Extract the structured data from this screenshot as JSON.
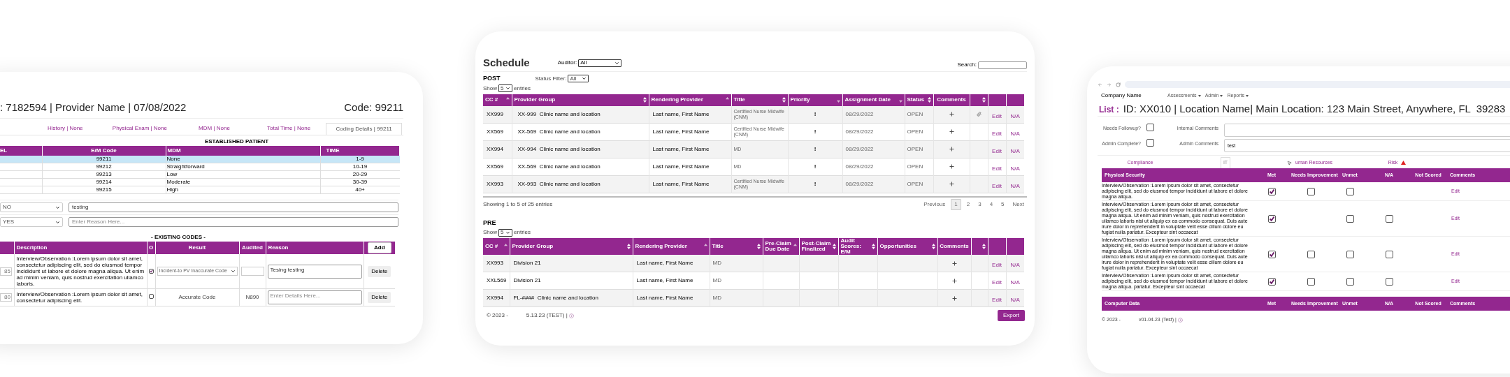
{
  "coding_card": {
    "heading": ": 7182594 | Provider Name | 07/08/2022",
    "code": "Code: 99211",
    "tabs": [
      {
        "label": "History | None",
        "selected": false
      },
      {
        "label": "Physical Exam | None",
        "selected": false
      },
      {
        "label": "MDM | None",
        "selected": false
      },
      {
        "label": "Total Time | None",
        "selected": false
      },
      {
        "label": "Coding Details | 99211",
        "selected": true
      }
    ],
    "table_title": "ESTABLISHED PATIENT",
    "columns": [
      "EL",
      "E/M Code",
      "MDM",
      "TIME"
    ],
    "rows": [
      {
        "code": "99211",
        "mdm": "None",
        "time": "1-9",
        "selected": true
      },
      {
        "code": "99212",
        "mdm": "Straightforward",
        "time": "10-19",
        "selected": false
      },
      {
        "code": "99213",
        "mdm": "Low",
        "time": "20-29",
        "selected": false
      },
      {
        "code": "99214",
        "mdm": "Moderate",
        "time": "30-39",
        "selected": false
      },
      {
        "code": "99215",
        "mdm": "High",
        "time": "40+",
        "selected": false
      }
    ],
    "reason_rows": [
      {
        "answer": "NO",
        "value": "testing"
      },
      {
        "answer": "YES",
        "placeholder": "Enter Reason Here..."
      }
    ],
    "codes_title": "- EXISTING CODES -",
    "codes_columns": [
      "Description",
      "O",
      "Result",
      "Audited",
      "Reason"
    ],
    "add_button": "Add",
    "codes": [
      {
        "code": "85",
        "description": "Interview/Observation :Lorem ipsum dolor sit amet, consectetur adipiscing elit, sed do eiusmod tempor incididunt ut labore et dolore magna aliqua. Ut enim ad minim veniam, quis nostrud exercitation ullamco laboris.",
        "checked": true,
        "kind": "select",
        "result": "Incident-to PV Inaccurate Code",
        "reason": "Tesing testing",
        "delete": "Delete"
      },
      {
        "code": "80",
        "description": "Interview/Observation :Lorem ipsum dolor sit amet, consectetur adipiscing elit.",
        "checked": false,
        "kind": "text",
        "result": "Accurate Code",
        "audited": "N890",
        "reason_placeholder": "Enter Details Here...",
        "delete": "Delete"
      }
    ]
  },
  "schedule_card": {
    "title": "Schedule",
    "auditor_label": "Auditor:",
    "auditor_value": "All",
    "search_label": "Search:",
    "post": {
      "title": "POST",
      "status_filter_label": "Status Filter:",
      "status_filter_value": "All",
      "show": "Show",
      "show_value": "5",
      "entries": "entries",
      "columns": [
        {
          "label": "CC #",
          "arrow_up": true,
          "arrow_down": false
        },
        {
          "label": "Provider Group",
          "arrow_up": true,
          "arrow_down": true
        },
        {
          "label": "Rendering Provider",
          "arrow_up": true,
          "arrow_down": false
        },
        {
          "label": "Title",
          "arrow_up": true,
          "arrow_down": true
        },
        {
          "label": "Priority",
          "arrow_up": false,
          "arrow_down": true
        },
        {
          "label": "Assignment Date",
          "arrow_up": false,
          "arrow_down": true
        },
        {
          "label": "Status",
          "arrow_up": true,
          "arrow_down": true
        },
        {
          "label": "Comments",
          "arrow_up": false,
          "arrow_down": false
        },
        {
          "arrow_up": true,
          "arrow_down": true
        },
        {
          "arrow_up": false,
          "arrow_down": false
        },
        {
          "arrow_up": false,
          "arrow_down": false
        }
      ],
      "rows": [
        {
          "cc": "XX999",
          "group": "XX-999  Clinic name and location",
          "provider": "Last name, First Name",
          "title": "Certified Nurse Midwife (CNM)",
          "priority": "!",
          "date": "08/29/2022",
          "status": "OPEN",
          "attachment": true,
          "edit": "Edit",
          "na": "N/A"
        },
        {
          "cc": "XX569",
          "group": "XX-569  Clinic name and location",
          "provider": "Last name, First Name",
          "title": "Certified Nurse Midwife (CNM)",
          "priority": "!",
          "date": "08/29/2022",
          "status": "OPEN",
          "attachment": false,
          "edit": "Edit",
          "na": "N/A"
        },
        {
          "cc": "XX994",
          "group": "XX-994  Clinic name and location",
          "provider": "Last name, First Name",
          "title": "MD",
          "priority": "!",
          "date": "08/29/2022",
          "status": "OPEN",
          "attachment": false,
          "edit": "Edit",
          "na": "N/A"
        },
        {
          "cc": "XX569",
          "group": "XX-569  Clinic name and location",
          "provider": "Last name, First Name",
          "title": "MD",
          "priority": "!",
          "date": "08/29/2022",
          "status": "OPEN",
          "attachment": false,
          "edit": "Edit",
          "na": "N/A"
        },
        {
          "cc": "XX993",
          "group": "XX-993  Clinic name and location",
          "provider": "Last name, First Name",
          "title": "Certified Nurse Midwife (CNM)",
          "priority": "!",
          "date": "08/29/2022",
          "status": "OPEN",
          "attachment": false,
          "edit": "Edit",
          "na": "N/A"
        }
      ],
      "info": "Showing 1 to 5 of 25 entries",
      "pagination": [
        {
          "label": "Previous",
          "selected": false
        },
        {
          "label": "1",
          "selected": true
        },
        {
          "label": "2",
          "selected": false
        },
        {
          "label": "3",
          "selected": false
        },
        {
          "label": "4",
          "selected": false
        },
        {
          "label": "5",
          "selected": false
        },
        {
          "label": "Next",
          "selected": false
        }
      ]
    },
    "pre": {
      "title": "PRE",
      "show": "Show",
      "show_value": "5",
      "entries": "entries",
      "columns": [
        {
          "label": "CC #",
          "arrow_up": true,
          "arrow_down": false
        },
        {
          "label": "Provider Group",
          "arrow_up": true,
          "arrow_down": true
        },
        {
          "label": "Rendering Provider",
          "arrow_up": true,
          "arrow_down": false
        },
        {
          "label": "Title",
          "arrow_up": true,
          "arrow_down": true
        },
        {
          "label": "Pre-Claim Due Date",
          "arrow_up": true,
          "arrow_down": false
        },
        {
          "label": "Post-Claim Finalized",
          "arrow_up": true,
          "arrow_down": true
        },
        {
          "label": "Audit Scores: E/M",
          "arrow_up": true,
          "arrow_down": true
        },
        {
          "label": "Opportunities",
          "arrow_up": true,
          "arrow_down": true
        },
        {
          "label": "Comments",
          "arrow_up": false,
          "arrow_down": false
        },
        {
          "arrow_up": true,
          "arrow_down": true
        },
        {
          "arrow_up": false,
          "arrow_down": false
        },
        {
          "arrow_up": false,
          "arrow_down": false
        }
      ],
      "rows": [
        {
          "cc": "XX993",
          "group": "Division 21",
          "provider": "Last name, First Name",
          "title": "MD",
          "edit": "Edit",
          "na": "N/A"
        },
        {
          "cc": "XXL569",
          "group": "Division 21",
          "provider": "Last name, First Name",
          "title": "MD",
          "edit": "Edit",
          "na": "N/A"
        },
        {
          "cc": "XX994",
          "group": "FL-####  Clinic name and location",
          "provider": "Last name, First Name",
          "title": "MD",
          "edit": "Edit",
          "na": "N/A"
        }
      ]
    },
    "footer": "© 2023 -",
    "version": "5.13.23 (TEST) |",
    "export": "Export"
  },
  "list_card": {
    "company": "Company Name",
    "menus": [
      "Assessments",
      "Admin",
      "Reports"
    ],
    "list_label": "List :",
    "list_heading": "ID: XX010 | Location Name| Main Location: 123 Main Street, Anywhere, FL  39283",
    "form": [
      {
        "label": "Needs Followup?",
        "checked": false,
        "comment_label": "Internal Comments"
      },
      {
        "label": "Admin Complete?",
        "checked": false,
        "comment_label": "Admin Comments",
        "comment_value": "test"
      }
    ],
    "tabs": [
      {
        "label": "Compliance",
        "selected": false,
        "warning": false
      },
      {
        "label": "IT",
        "selected": true,
        "warning": false
      },
      {
        "label": "uman Resources",
        "selected": false,
        "warning": false
      },
      {
        "label": "Risk",
        "selected": false,
        "warning": true
      }
    ],
    "sections": [
      {
        "title": "Physical Security",
        "columns": [
          "Met",
          "Needs Improvement",
          "Unmet",
          "N/A",
          "Not Scored",
          "Comments"
        ],
        "rows": [
          {
            "text": "Interview/Observation :Lorem ipsum dolor sit amet, consectetur adipiscing elit, sed do eiusmod tempor incididunt ut labore et dolore magna aliqua.",
            "marks": {
              "met": true,
              "needs_improvement": false,
              "unmet": false
            },
            "edit": "Edit"
          },
          {
            "text": "Interview/Observation :Lorem ipsum dolor sit amet, consectetur adipiscing elit, sed do eiusmod tempor incididunt ut labore et dolore magna aliqua. Ut enim ad minim veniam, quis nostrud exercitation ullamco laboris nisi ut aliquip ex ea commodo consequat. Duis aute irure dolor in reprehenderit in voluptate velit esse cillum dolore eu fugiat nulla pariatur. Excepteur sint occaecat",
            "marks": {
              "met": true,
              "unmet": false,
              "na": false
            },
            "edit": "Edit"
          },
          {
            "text": "Interview/Observation :Lorem ipsum dolor sit amet, consectetur adipiscing elit, sed do eiusmod tempor incididunt ut labore et dolore magna aliqua. Ut enim ad minim veniam, quis nostrud exercitation ullamco laboris nisi ut aliquip ex ea commodo consequat. Duis aute irure dolor in reprehenderit in voluptate velit esse cillum dolore eu fugiat nulla pariatur. Excepteur sint occaecat",
            "marks": {
              "met": true,
              "needs_improvement": false,
              "unmet": false,
              "na": false
            },
            "edit": "Edit"
          },
          {
            "text": "Interview/Observation :Lorem ipsum dolor sit amet, consectetur adipiscing elit, sed do eiusmod tempor incididunt ut labore et dolore magna aliqua. pariatur. Excepteur sint occaecat",
            "marks": {
              "met": true,
              "needs_improvement": false,
              "unmet": false,
              "na": false
            },
            "edit": "Edit"
          }
        ]
      },
      {
        "title": "Computer Data",
        "columns": [
          "Met",
          "Needs Improvement",
          "Unmet",
          "N/A",
          "Not Scored",
          "Comments"
        ]
      }
    ],
    "footer": "© 2023 -",
    "version": "v01.04.23 (Test) |"
  }
}
